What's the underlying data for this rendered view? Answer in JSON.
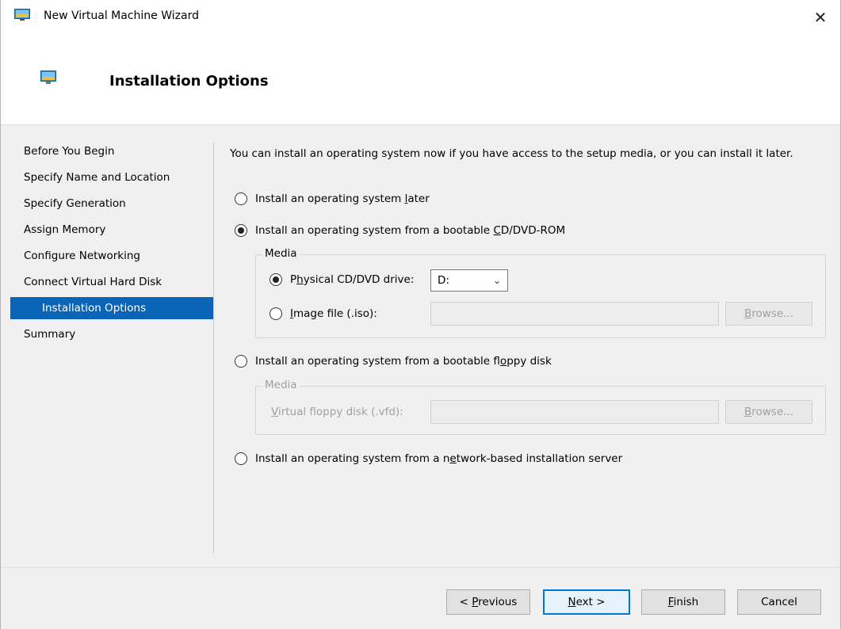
{
  "window": {
    "title": "New Virtual Machine Wizard",
    "close_glyph": "✕",
    "icon": "vm-monitor-icon"
  },
  "header": {
    "title": "Installation Options",
    "icon": "vm-monitor-icon"
  },
  "sidebar": {
    "items": [
      {
        "label": "Before You Begin",
        "current": false
      },
      {
        "label": "Specify Name and Location",
        "current": false
      },
      {
        "label": "Specify Generation",
        "current": false
      },
      {
        "label": "Assign Memory",
        "current": false
      },
      {
        "label": "Configure Networking",
        "current": false
      },
      {
        "label": "Connect Virtual Hard Disk",
        "current": false
      },
      {
        "label": "Installation Options",
        "current": true
      },
      {
        "label": "Summary",
        "current": false
      }
    ]
  },
  "main": {
    "intro": "You can install an operating system now if you have access to the setup media, or you can install it later.",
    "options": {
      "later": {
        "label_pre": "Install an operating system ",
        "label_key": "l",
        "label_post": "ater",
        "checked": false
      },
      "cdrom": {
        "label_pre": "Install an operating system from a bootable ",
        "label_key": "C",
        "label_post": "D/DVD-ROM",
        "checked": true
      },
      "floppy": {
        "label_pre": "Install an operating system from a bootable fl",
        "label_key": "o",
        "label_post": "ppy disk",
        "checked": false
      },
      "network": {
        "label_pre": "Install an operating system from a n",
        "label_key": "e",
        "label_post": "twork-based installation server",
        "checked": false
      }
    },
    "cd_media": {
      "legend": "Media",
      "physical": {
        "label_pre": "P",
        "label_key": "h",
        "label_post": "ysical CD/DVD drive:",
        "checked": true,
        "value": "D:"
      },
      "image": {
        "label_pre": "",
        "label_key": "I",
        "label_post": "mage file (.iso):",
        "checked": false,
        "value": ""
      },
      "browse_label_key": "B",
      "browse_label_post": "rowse..."
    },
    "floppy_media": {
      "legend": "Media",
      "label_pre": "",
      "label_key": "V",
      "label_post": "irtual floppy disk (.vfd):",
      "value": "",
      "browse_label_key": "B",
      "browse_label_post": "rowse..."
    }
  },
  "footer": {
    "previous": {
      "pre": "< ",
      "key": "P",
      "post": "revious"
    },
    "next": {
      "pre": "",
      "key": "N",
      "post": "ext >"
    },
    "finish": {
      "pre": "",
      "key": "F",
      "post": "inish"
    },
    "cancel": "Cancel"
  },
  "colors": {
    "selection": "#0a64b8",
    "default_button_border": "#0078d7"
  }
}
